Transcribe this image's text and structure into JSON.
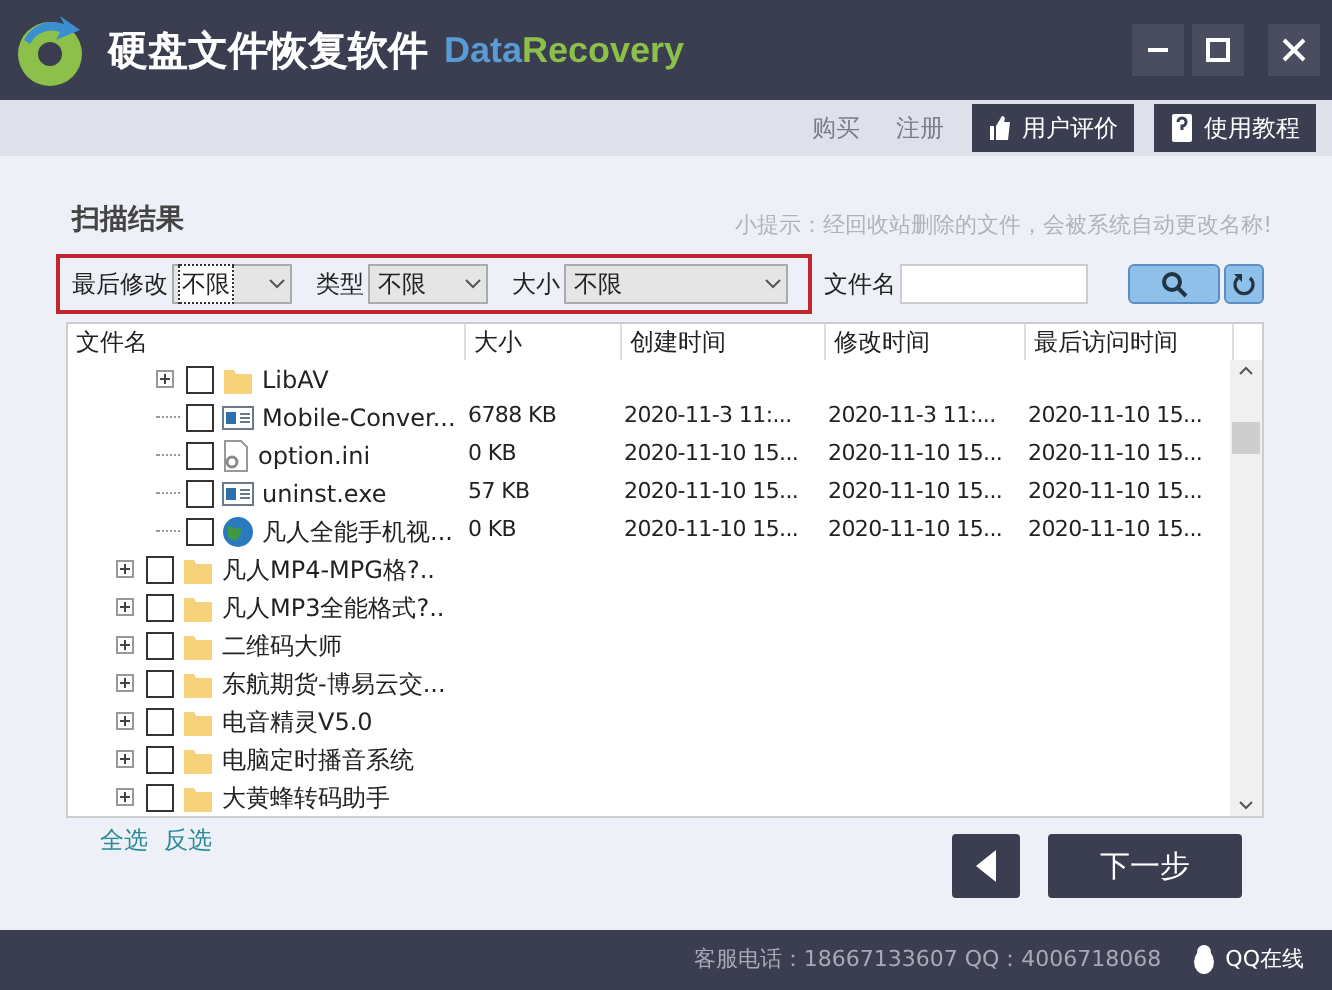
{
  "window": {
    "title": "硬盘文件恢复软件",
    "brand_part_1": "Data",
    "brand_part_2": "Recovery"
  },
  "toolbar": {
    "links": [
      "购买",
      "注册"
    ],
    "buttons": [
      {
        "label": "用户评价",
        "kind": "thumb"
      },
      {
        "label": "使用教程",
        "kind": "book"
      }
    ]
  },
  "section_title": "扫描结果",
  "tip": "小提示：经回收站删除的文件，会被系统自动更改名称!",
  "filters": [
    {
      "label": "最后修改",
      "value": "不限",
      "focused": true,
      "kind": "short"
    },
    {
      "label": "类型",
      "value": "不限",
      "focused": false,
      "kind": "short"
    },
    {
      "label": "大小",
      "value": "不限",
      "focused": false,
      "kind": "long"
    }
  ],
  "filename_label": "文件名",
  "table": {
    "columns": [
      "文件名",
      "大小",
      "创建时间",
      "修改时间",
      "最后访问时间"
    ],
    "tree": [
      {
        "children": [
          {
            "name": "LibAV",
            "kind": "folder",
            "expanded": false,
            "checked": false
          },
          {
            "name": "Mobile-Conver...",
            "kind": "exe",
            "checked": false,
            "size": "6788 KB",
            "created": "2020-11-3 11:...",
            "modified": "2020-11-3 11:...",
            "accessed": "2020-11-10 15..."
          },
          {
            "name": "option.ini",
            "kind": "ini",
            "checked": false,
            "size": "0 KB",
            "created": "2020-11-10 15...",
            "modified": "2020-11-10 15...",
            "accessed": "2020-11-10 15..."
          },
          {
            "name": "uninst.exe",
            "kind": "exe",
            "checked": false,
            "size": "57 KB",
            "created": "2020-11-10 15...",
            "modified": "2020-11-10 15...",
            "accessed": "2020-11-10 15..."
          },
          {
            "name": "凡人全能手机视...",
            "kind": "globe",
            "checked": false,
            "size": "0 KB",
            "created": "2020-11-10 15...",
            "modified": "2020-11-10 15...",
            "accessed": "2020-11-10 15..."
          }
        ]
      },
      {
        "name": "凡人MP4-MPG格?..",
        "kind": "folder",
        "expanded": false,
        "checked": false
      },
      {
        "name": "凡人MP3全能格式?..",
        "kind": "folder",
        "expanded": false,
        "checked": false
      },
      {
        "name": "二维码大师",
        "kind": "folder",
        "expanded": false,
        "checked": false
      },
      {
        "name": "东航期货-博易云交...",
        "kind": "folder",
        "expanded": false,
        "checked": false
      },
      {
        "name": "电音精灵V5.0",
        "kind": "folder",
        "expanded": false,
        "checked": false
      },
      {
        "name": "电脑定时播音系统",
        "kind": "folder",
        "expanded": false,
        "checked": false
      },
      {
        "name": "大黄蜂转码助手",
        "kind": "folder",
        "expanded": false,
        "checked": false
      }
    ]
  },
  "select_links": [
    "全选",
    "反选"
  ],
  "next_button": "下一步",
  "footer": {
    "contact": "客服电话：18667133607 QQ：4006718068",
    "qq": "QQ在线"
  }
}
